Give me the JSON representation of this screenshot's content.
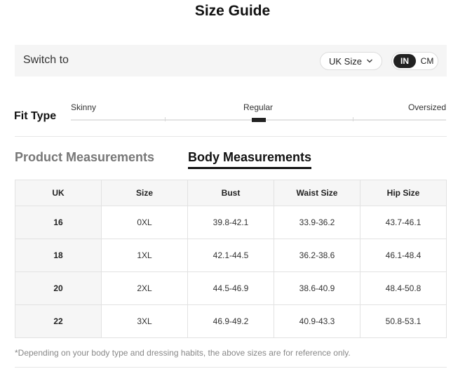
{
  "title": "Size Guide",
  "switch": {
    "label": "Switch to",
    "size_system": "UK Size",
    "units": {
      "active": "IN",
      "inactive": "CM"
    }
  },
  "fit": {
    "label": "Fit Type",
    "options": [
      "Skinny",
      "Regular",
      "Oversized"
    ],
    "selected": "Regular"
  },
  "tabs": {
    "product": "Product Measurements",
    "body": "Body Measurements",
    "active": "Body Measurements"
  },
  "table": {
    "headers": [
      "UK",
      "Size",
      "Bust",
      "Waist Size",
      "Hip Size"
    ],
    "rows": [
      [
        "16",
        "0XL",
        "39.8-42.1",
        "33.9-36.2",
        "43.7-46.1"
      ],
      [
        "18",
        "1XL",
        "42.1-44.5",
        "36.2-38.6",
        "46.1-48.4"
      ],
      [
        "20",
        "2XL",
        "44.5-46.9",
        "38.6-40.9",
        "48.4-50.8"
      ],
      [
        "22",
        "3XL",
        "46.9-49.2",
        "40.9-43.3",
        "50.8-53.1"
      ]
    ]
  },
  "footnote": "*Depending on your body type and dressing habits, the above sizes are for reference only.",
  "icons": {
    "size_dropdown": "chevron-down-icon"
  }
}
